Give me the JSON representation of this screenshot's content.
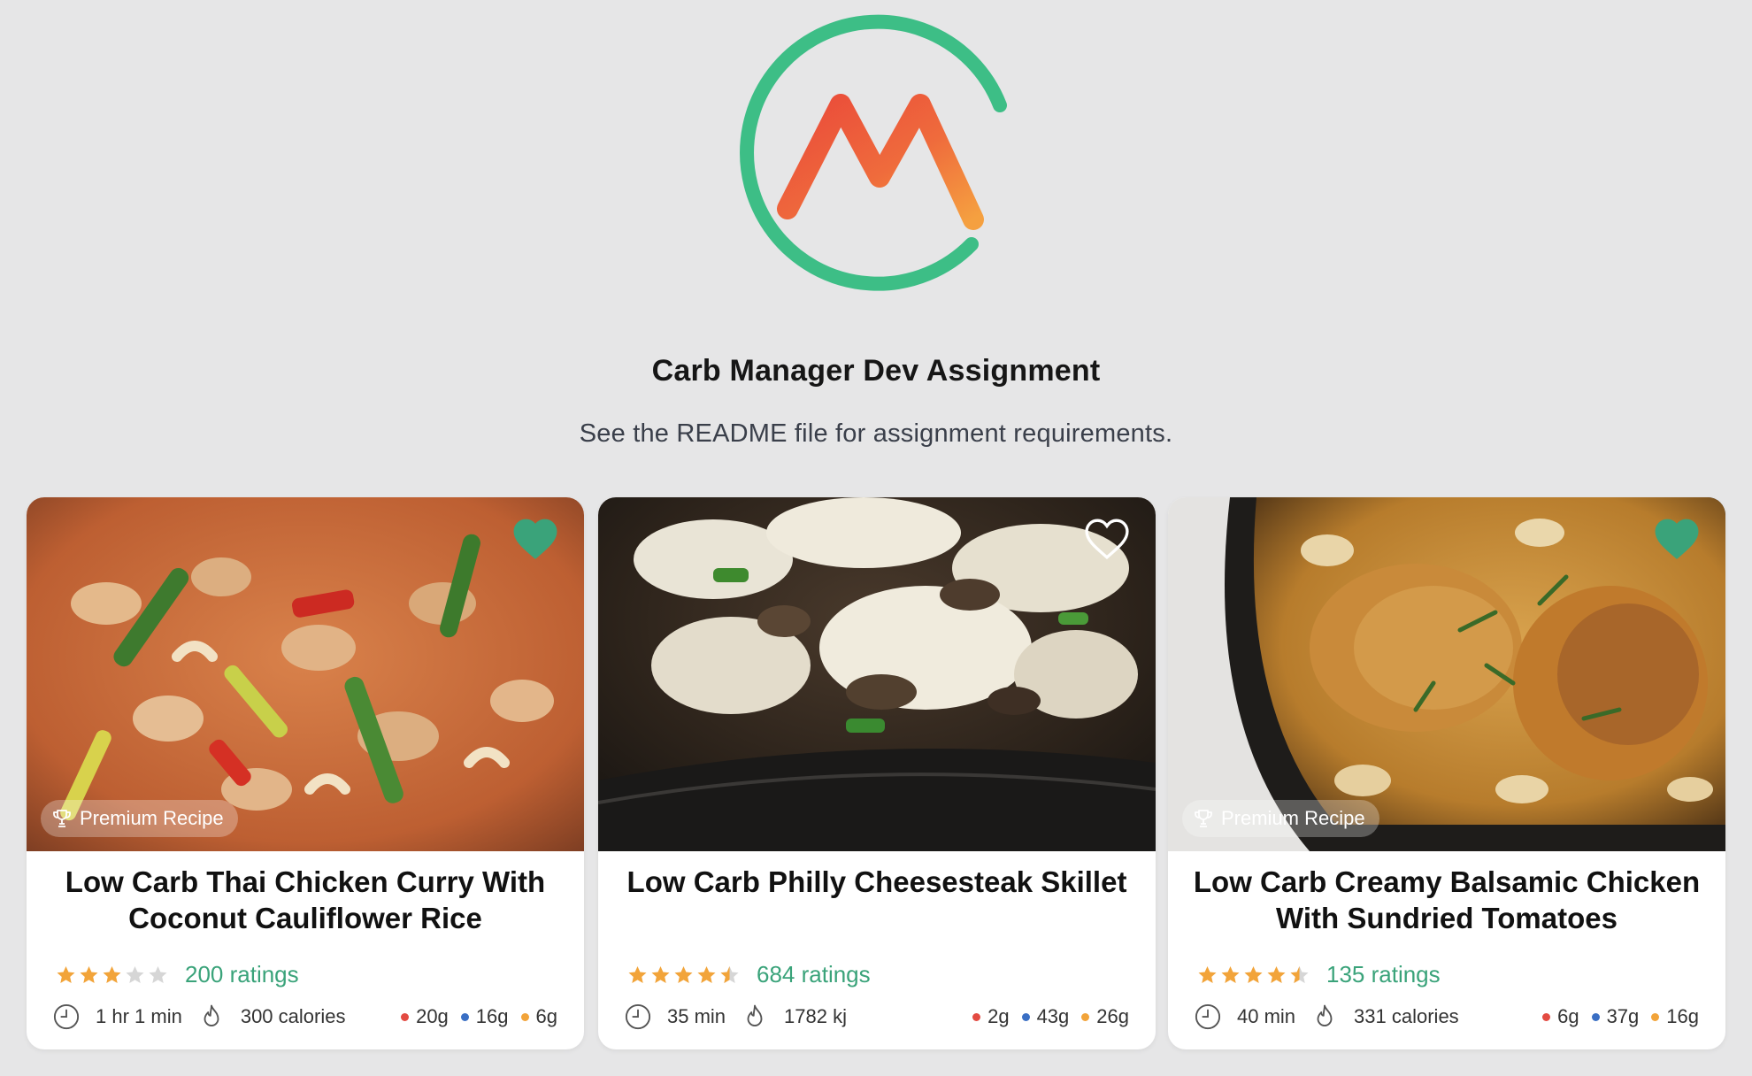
{
  "header": {
    "title": "Carb Manager Dev Assignment",
    "subtitle": "See the README file for assignment requirements."
  },
  "colors": {
    "background": "#e6e6e7",
    "brand_green": "#3aa37a",
    "logo_green": "#3dbe86",
    "logo_red": "#ea4a3a",
    "logo_orange": "#f5a040",
    "star": "#f2a43a",
    "star_empty": "#d6d6d6",
    "carbs_dot": "#e34b42",
    "protein_dot": "#3a6fc4",
    "fat_dot": "#f2a43a"
  },
  "premium_label": "Premium Recipe",
  "recipes": [
    {
      "name": "Low Carb Thai Chicken Curry With Coconut Cauliflower Rice",
      "favorited": true,
      "favorite_icon": "heart-filled",
      "premium": true,
      "rating": 3,
      "rating_count": "200 ratings",
      "time": "1 hr 1 min",
      "energy": "300 calories",
      "macros": [
        "20g",
        "16g",
        "6g"
      ]
    },
    {
      "name": "Low Carb Philly Cheesesteak Skillet",
      "favorited": false,
      "favorite_icon": "heart-outline",
      "premium": false,
      "rating": 4.5,
      "rating_count": "684 ratings",
      "time": "35 min",
      "energy": "1782 kj",
      "macros": [
        "2g",
        "43g",
        "26g"
      ]
    },
    {
      "name": "Low Carb Creamy Balsamic Chicken With Sundried Tomatoes",
      "favorited": true,
      "favorite_icon": "heart-filled",
      "premium": true,
      "rating": 4.5,
      "rating_count": "135 ratings",
      "time": "40 min",
      "energy": "331 calories",
      "macros": [
        "6g",
        "37g",
        "16g"
      ]
    }
  ]
}
